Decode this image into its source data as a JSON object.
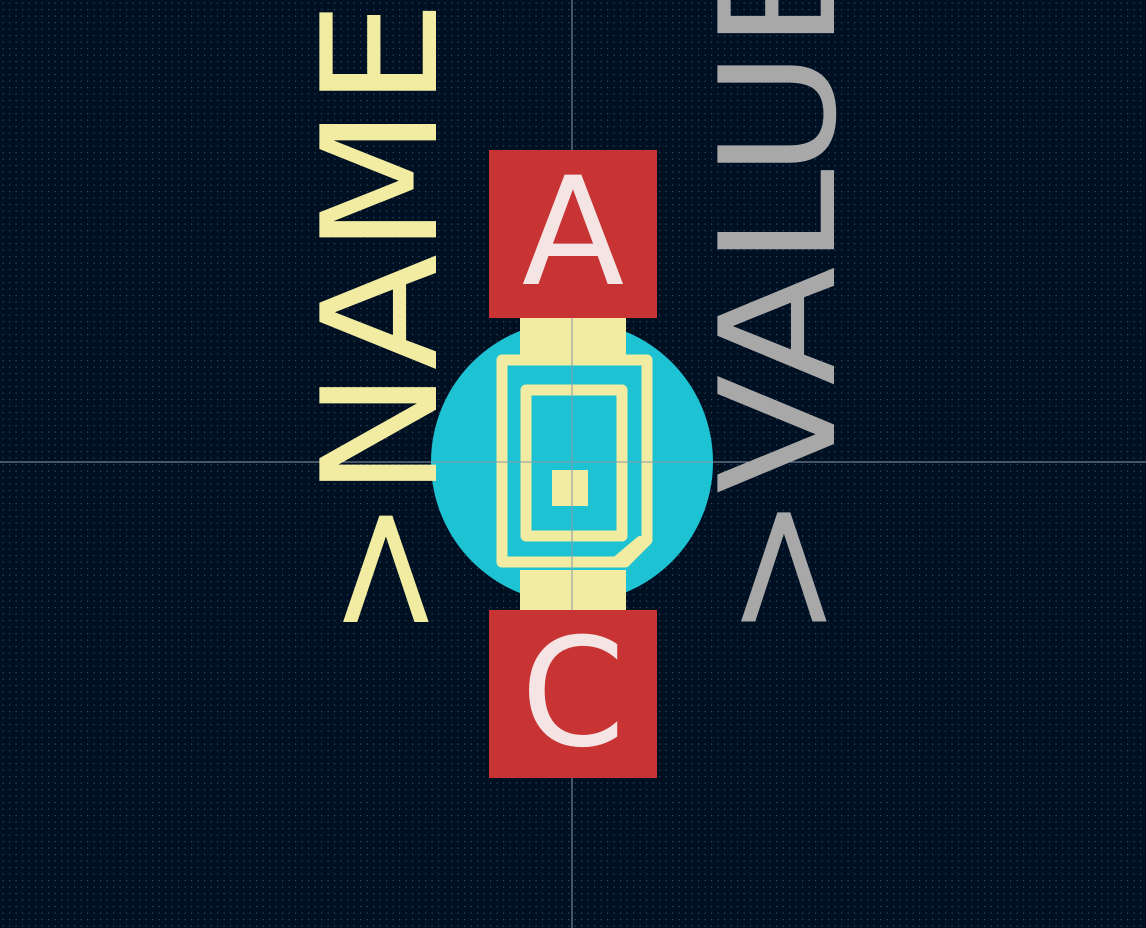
{
  "editor": {
    "view": "footprint-editor-canvas"
  },
  "colors": {
    "background": "#001023",
    "grid_dot": "#3a4a60",
    "crosshair": "#8a98aa",
    "pad_smd": "#c83434",
    "pad_label": "#f4e4e4",
    "silkscreen": "#f2eca2",
    "fab_outline": "#f2eca2",
    "courtyard_fill": "#1ec3d3",
    "value_text": "#a8a8a8"
  },
  "footprint": {
    "reference_text": ">NAME",
    "value_text": ">VALUE",
    "pads": [
      {
        "label": "A"
      },
      {
        "label": "C"
      }
    ]
  }
}
